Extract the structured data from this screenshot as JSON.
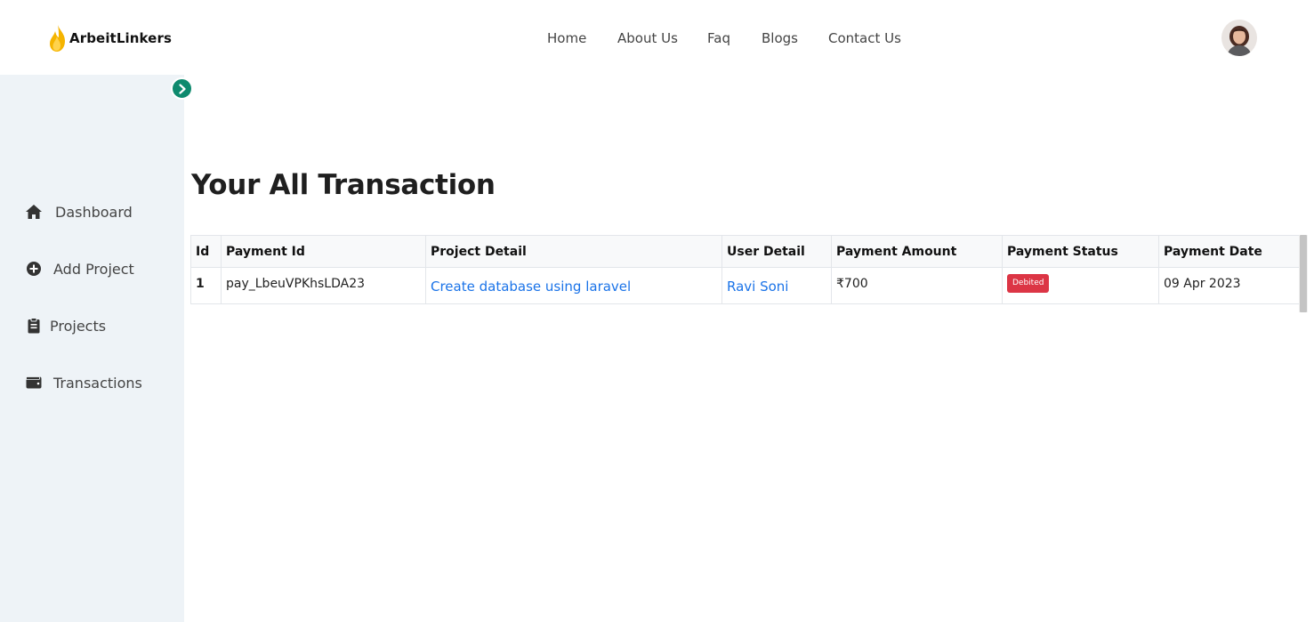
{
  "header": {
    "brand": "ArbeitLinkers",
    "nav": {
      "home": "Home",
      "about": "About Us",
      "faq": "Faq",
      "blogs": "Blogs",
      "contact": "Contact Us"
    }
  },
  "sidebar": {
    "items": [
      {
        "label": "Dashboard",
        "icon": "home-icon"
      },
      {
        "label": "Add Project",
        "icon": "plus-circle-icon"
      },
      {
        "label": "Projects",
        "icon": "clipboard-icon"
      },
      {
        "label": "Transactions",
        "icon": "wallet-icon"
      }
    ]
  },
  "main": {
    "title": "Your All Transaction",
    "table": {
      "headers": [
        "Id",
        "Payment Id",
        "Project Detail",
        "User Detail",
        "Payment Amount",
        "Payment Status",
        "Payment Date"
      ],
      "rows": [
        {
          "id": "1",
          "payment_id": "pay_LbeuVPKhsLDA23",
          "project": "Create database using laravel",
          "user": "Ravi Soni",
          "amount": "₹700",
          "status": "Debited",
          "date": "09 Apr 2023"
        }
      ]
    }
  },
  "colors": {
    "accent": "#0e8a6e",
    "sidebar_bg": "#eef3f7",
    "link": "#1a73e8",
    "status_debited": "#dc3545",
    "logo": "#f5b400"
  }
}
